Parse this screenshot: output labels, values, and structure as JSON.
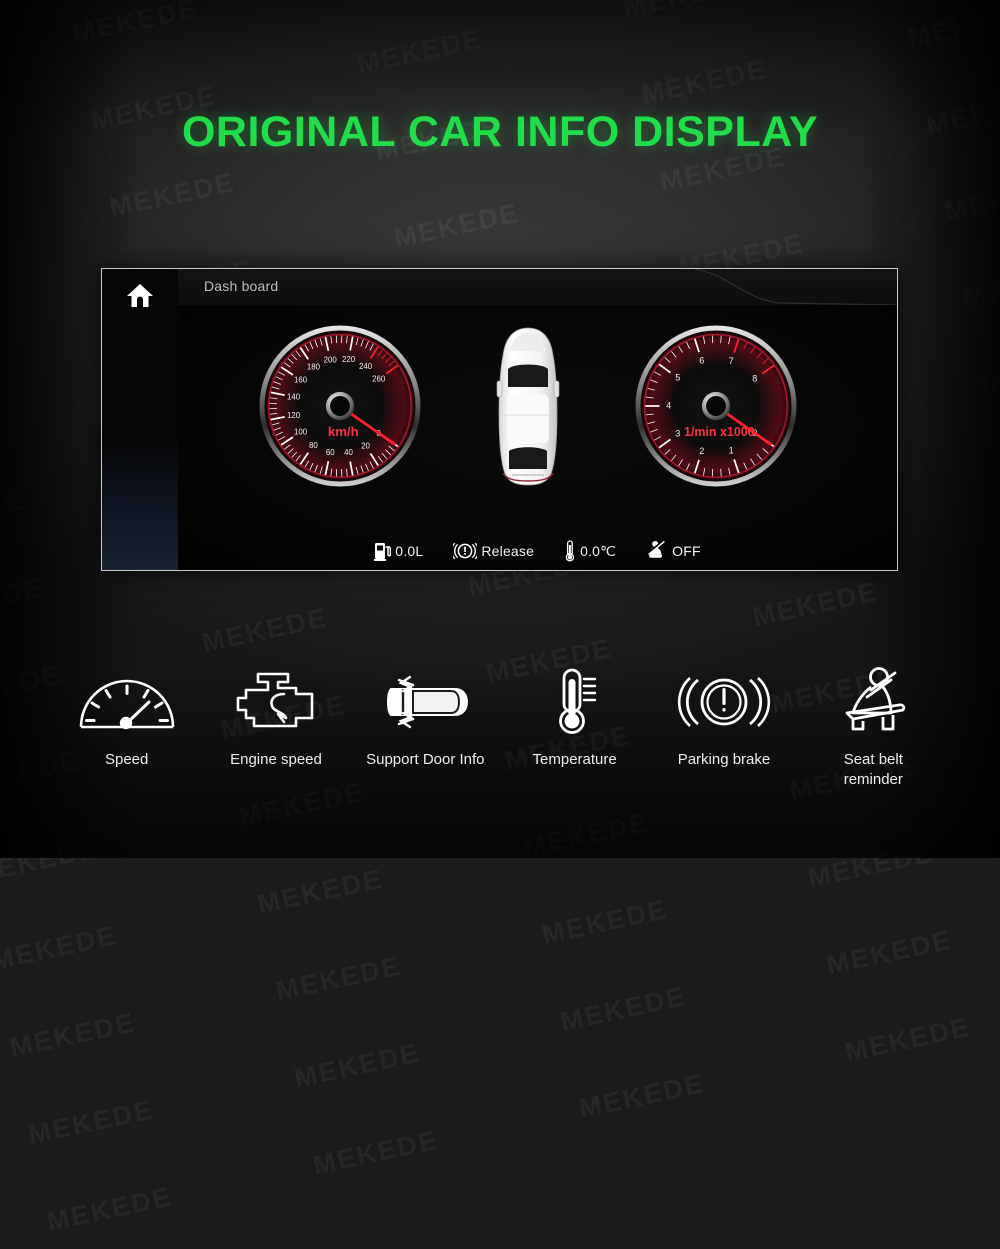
{
  "page": {
    "title": "ORIGINAL CAR INFO DISPLAY",
    "title_color": "#22dd4a",
    "background_color": "#1c1c1c",
    "watermark_text": "MEKEDE"
  },
  "panel": {
    "header_title": "Dash board",
    "home_icon": "home-icon",
    "border_color": "#c9c9c9",
    "background_color": "#050505"
  },
  "speedometer": {
    "icon": "speedometer-gauge",
    "unit_label": "km/h",
    "unit_color": "#ff2d3c",
    "value": 0,
    "min": 0,
    "max": 260,
    "major_step": 20,
    "tick_labels": [
      "0",
      "20",
      "40",
      "60",
      "80",
      "100",
      "120",
      "140",
      "160",
      "180",
      "200",
      "220",
      "240",
      "260"
    ],
    "redline_start": 240,
    "needle_color": "#ff1f2e"
  },
  "tachometer": {
    "icon": "tachometer-gauge",
    "unit_label": "1/min x1000",
    "unit_color": "#ff2d3c",
    "value": 0,
    "min": 0,
    "max": 8,
    "major_step": 1,
    "tick_labels": [
      "0",
      "1",
      "2",
      "3",
      "4",
      "5",
      "6",
      "7",
      "8"
    ],
    "redline_start": 7,
    "needle_color": "#ff1f2e"
  },
  "car": {
    "icon": "car-top-view",
    "color": "#f4f4f4"
  },
  "status": [
    {
      "icon": "fuel-pump-icon",
      "label": "0.0L"
    },
    {
      "icon": "brake-warning-icon",
      "label": "Release"
    },
    {
      "icon": "thermometer-icon",
      "label": "0.0℃"
    },
    {
      "icon": "seatbelt-icon",
      "label": "OFF"
    }
  ],
  "features": [
    {
      "icon": "speed-gauge-icon",
      "label": "Speed"
    },
    {
      "icon": "engine-check-icon",
      "label": "Engine speed"
    },
    {
      "icon": "car-door-icon",
      "label": "Support Door Info"
    },
    {
      "icon": "thermometer-icon",
      "label": "Temperature"
    },
    {
      "icon": "parking-brake-icon",
      "label": "Parking brake"
    },
    {
      "icon": "seatbelt-reminder-icon",
      "label": "Seat belt\nreminder"
    }
  ]
}
